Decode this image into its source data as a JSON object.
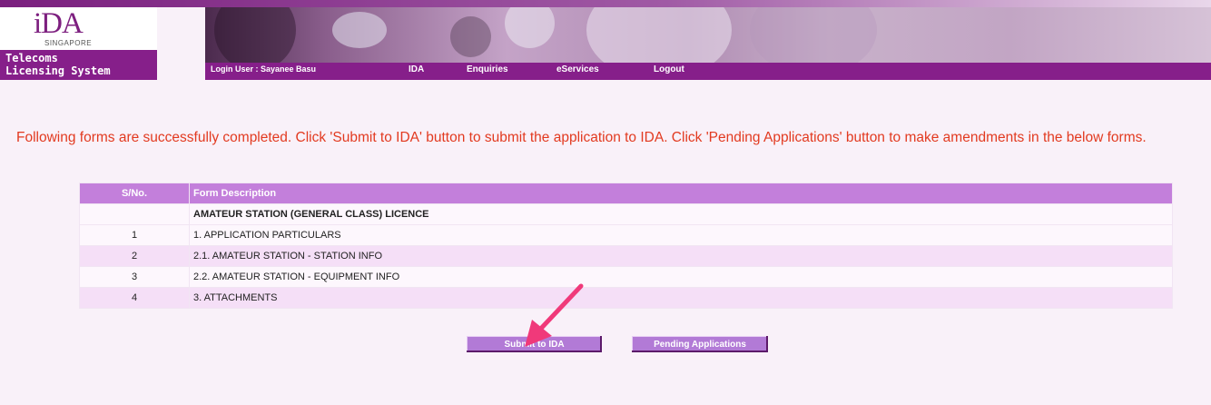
{
  "logo": {
    "brand": "iDA",
    "country": "SINGAPORE",
    "system_line1": "Telecoms",
    "system_line2": "Licensing System"
  },
  "nav": {
    "login_user": "Login User : Sayanee Basu",
    "items": [
      "IDA",
      "Enquiries",
      "eServices",
      "Logout"
    ]
  },
  "message": "Following forms are successfully completed. Click 'Submit to IDA' button to submit the application to IDA. Click 'Pending Applications' button to make amendments in the below forms.",
  "table": {
    "headers": [
      "S/No.",
      "Form Description"
    ],
    "section": "AMATEUR STATION (GENERAL CLASS) LICENCE",
    "rows": [
      {
        "sn": "1",
        "desc": "1. APPLICATION PARTICULARS"
      },
      {
        "sn": "2",
        "desc": "2.1. AMATEUR STATION - STATION INFO"
      },
      {
        "sn": "3",
        "desc": "2.2. AMATEUR STATION - EQUIPMENT INFO"
      },
      {
        "sn": "4",
        "desc": "3. ATTACHMENTS"
      }
    ]
  },
  "buttons": {
    "submit": "Submit to IDA",
    "pending": "Pending Applications"
  },
  "colors": {
    "brand_purple": "#861f8a",
    "header_purple": "#c37fdb",
    "message_red": "#e23a20",
    "arrow_pink": "#f0397a"
  }
}
